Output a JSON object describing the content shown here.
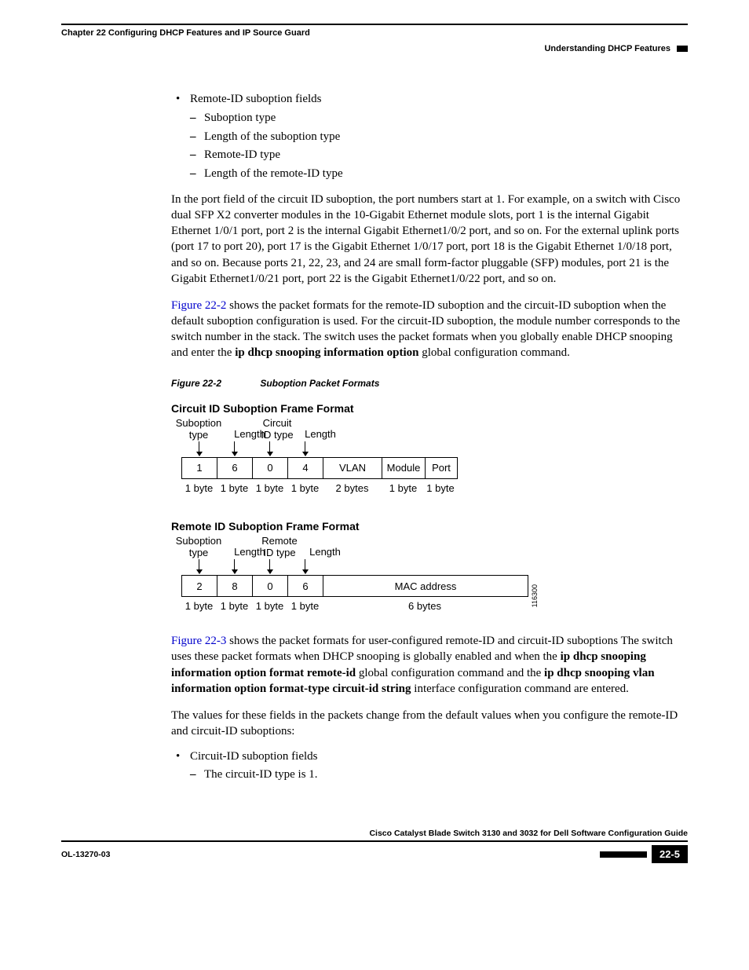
{
  "header": {
    "chapter": "Chapter 22      Configuring DHCP Features and IP Source Guard",
    "section": "Understanding DHCP Features"
  },
  "bullets": {
    "b1": "Remote-ID suboption fields",
    "d1": "Suboption type",
    "d2": "Length of the suboption type",
    "d3": "Remote-ID type",
    "d4": "Length of the remote-ID type"
  },
  "para1": "In the port field of the circuit ID suboption, the port numbers start at 1. For example, on a switch with Cisco dual SFP X2 converter modules in the 10-Gigabit Ethernet module slots, port 1 is the internal Gigabit Ethernet 1/0/1 port, port 2 is the internal Gigabit Ethernet1/0/2 port, and so on. For the external uplink ports (port 17 to port 20), port 17 is the Gigabit Ethernet 1/0/17 port, port 18 is the Gigabit Ethernet 1/0/18 port, and so on. Because ports 21, 22, 23, and 24 are small form-factor pluggable (SFP) modules, port 21 is the Gigabit Ethernet1/0/21 port, port 22 is the Gigabit Ethernet1/0/22 port, and so on.",
  "para2a": "Figure 22-2",
  "para2b_part1": " shows the packet formats for the remote-ID suboption and the circuit-ID suboption when the default suboption configuration is used. For the circuit-ID suboption, the module number corresponds to the switch number in the stack. The switch uses the packet formats when you globally enable DHCP snooping and enter the ",
  "para2b_bold": "ip dhcp snooping information option",
  "para2b_part2": " global configuration command.",
  "figlabel": {
    "num": "Figure 22-2",
    "title": "Suboption Packet Formats"
  },
  "fig1": {
    "title": "Circuit ID Suboption Frame Format",
    "lab_subtype": "Suboption\ntype",
    "lab_len1": "Length",
    "lab_cirtype": "Circuit\nID type",
    "lab_len2": "Length",
    "cells": [
      "1",
      "6",
      "0",
      "4",
      "VLAN",
      "Module",
      "Port"
    ],
    "sizes": [
      "1 byte",
      "1 byte",
      "1 byte",
      "1 byte",
      "2 bytes",
      "1 byte",
      "1 byte"
    ]
  },
  "fig2": {
    "title": "Remote ID Suboption Frame Format",
    "lab_subtype": "Suboption\ntype",
    "lab_len1": "Length",
    "lab_remtype": "Remote\nID type",
    "lab_len2": "Length",
    "cells": [
      "2",
      "8",
      "0",
      "6",
      "MAC address"
    ],
    "sizes": [
      "1 byte",
      "1 byte",
      "1 byte",
      "1 byte",
      "6 bytes"
    ],
    "sidecode": "116300"
  },
  "para3a": "Figure 22-3",
  "para3b_part1": " shows the packet formats for user-configured remote-ID and circuit-ID suboptions The switch uses these packet formats when DHCP snooping is globally enabled and when the ",
  "para3b_bold1": "ip dhcp snooping information option format remote-id ",
  "para3b_mid": "global configuration command and the ",
  "para3b_bold2": "ip dhcp snooping vlan information option format-type circuit-id string ",
  "para3b_part2": "interface configuration command are entered.",
  "para4": "The values for these fields in the packets change from the default values when you configure the remote-ID and circuit-ID suboptions:",
  "bullets2": {
    "b1": "Circuit-ID suboption fields",
    "d1": "The circuit-ID type is 1."
  },
  "footer": {
    "guide": "Cisco Catalyst Blade Switch 3130 and 3032 for Dell Software Configuration Guide",
    "docid": "OL-13270-03",
    "pagenum": "22-5"
  }
}
